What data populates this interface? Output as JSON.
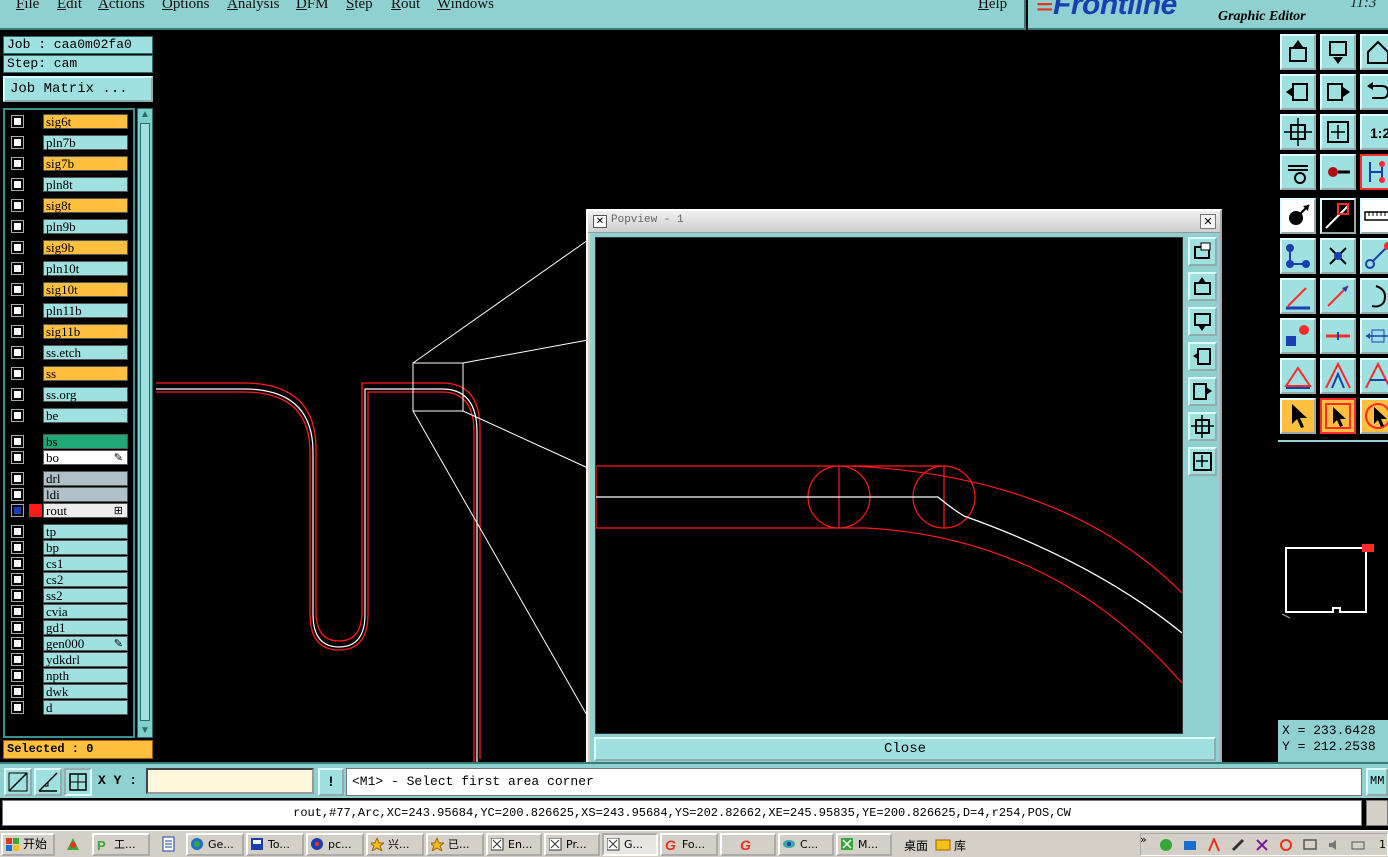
{
  "menu": {
    "items": [
      "File",
      "Edit",
      "Actions",
      "Options",
      "Analysis",
      "DFM",
      "Step",
      "Rout",
      "Windows"
    ],
    "help": "Help"
  },
  "brand": {
    "logo": "Frontline",
    "subtitle": "Graphic Editor",
    "clock": "11:3"
  },
  "job": {
    "job_line": "Job : caa0m02fa0",
    "step_line": "Step: cam",
    "matrix_button": "Job Matrix ..."
  },
  "layers": [
    {
      "name": "sig6t",
      "kind": "sig"
    },
    {
      "name": "pln7b",
      "kind": "pln"
    },
    {
      "name": "sig7b",
      "kind": "sig"
    },
    {
      "name": "pln8t",
      "kind": "pln"
    },
    {
      "name": "sig8t",
      "kind": "sig"
    },
    {
      "name": "pln9b",
      "kind": "pln"
    },
    {
      "name": "sig9b",
      "kind": "sig"
    },
    {
      "name": "pln10t",
      "kind": "pln"
    },
    {
      "name": "sig10t",
      "kind": "sig"
    },
    {
      "name": "pln11b",
      "kind": "pln"
    },
    {
      "name": "sig11b",
      "kind": "sig"
    },
    {
      "name": "ss.etch",
      "kind": "sm"
    },
    {
      "name": "ss",
      "kind": "sig"
    },
    {
      "name": "ss.org",
      "kind": "sm"
    },
    {
      "name": "be",
      "kind": "sm"
    },
    {
      "name": "bs",
      "kind": "bs"
    },
    {
      "name": "bo",
      "kind": "bo",
      "mark": "✎"
    },
    {
      "name": "drl",
      "kind": "drl"
    },
    {
      "name": "ldi",
      "kind": "drl"
    },
    {
      "name": "rout",
      "kind": "rout",
      "mark": "⊞",
      "affected": true
    },
    {
      "name": "tp",
      "kind": "misc"
    },
    {
      "name": "bp",
      "kind": "misc"
    },
    {
      "name": "cs1",
      "kind": "misc"
    },
    {
      "name": "cs2",
      "kind": "misc"
    },
    {
      "name": "ss2",
      "kind": "misc"
    },
    {
      "name": "cvia",
      "kind": "misc"
    },
    {
      "name": "gd1",
      "kind": "misc"
    },
    {
      "name": "gen000",
      "kind": "misc",
      "mark": "✎"
    },
    {
      "name": "ydkdrl",
      "kind": "misc"
    },
    {
      "name": "npth",
      "kind": "misc"
    },
    {
      "name": "dwk",
      "kind": "misc"
    },
    {
      "name": "d",
      "kind": "misc"
    }
  ],
  "selected": "Selected : 0",
  "popview": {
    "title": "Popview - 1",
    "close_label": "Close"
  },
  "coords": {
    "x": "X = 233.6428",
    "y": "Y = 212.2538"
  },
  "command": {
    "xy_label": "X Y :",
    "xy_value": "",
    "prompt": "<M1> - Select first area corner",
    "units": "MM"
  },
  "info": "rout,#77,Arc,XC=243.95684,YC=200.826625,XS=243.95684,YS=202.82662,XE=245.95835,YE=200.826625,D=4,r254,POS,CW",
  "taskbar": {
    "start": "开始",
    "tasks": [
      "工...",
      "Ge...",
      "To...",
      "pc...",
      "兴...",
      "已...",
      "En...",
      "Pr...",
      "G...",
      "Fo...",
      "",
      "C...",
      "M..."
    ],
    "desktop": "桌面",
    "library": "库",
    "tray_time": "1"
  },
  "colors": {
    "panel": "#8fd0d0",
    "button": "#9fe0e0",
    "signal_layer": "#ffc040",
    "trace": "#ff1a1a"
  }
}
